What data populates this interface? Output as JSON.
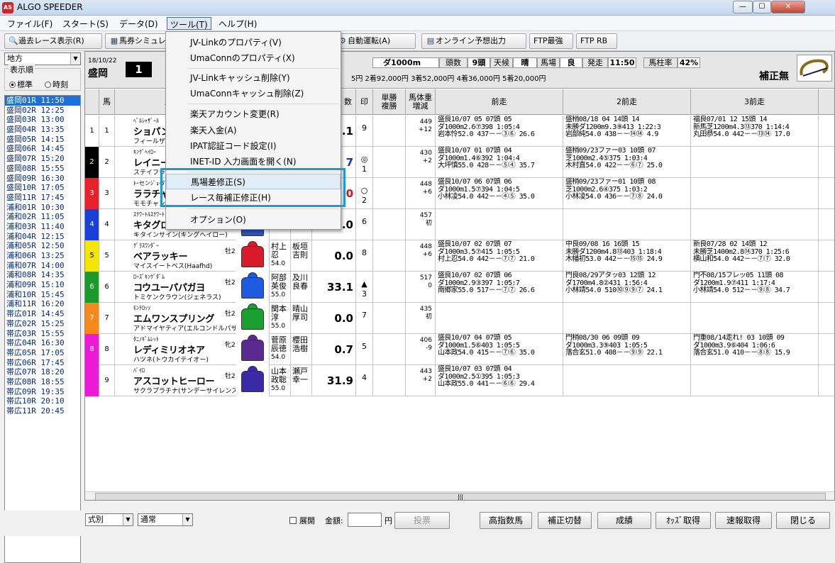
{
  "app": {
    "title": "ALGO SPEEDER",
    "logo": "AS"
  },
  "window": {
    "minimize": "—",
    "maximize": "☐",
    "close": "✕"
  },
  "menus": [
    "ファイル(F)",
    "スタート(S)",
    "データ(D)",
    "ツール(T)",
    "ヘルプ(H)"
  ],
  "toolbar": [
    {
      "label": "過去レース表示(R)",
      "icon": "magnifier-icon"
    },
    {
      "label": "馬券シミュレ",
      "icon": "calculator-icon"
    },
    {
      "label": "自動運転(A)",
      "icon": "auto-icon"
    },
    {
      "label": "オンライン予想出力",
      "icon": "print-icon"
    },
    {
      "label": "FTP最強",
      "icon": ""
    },
    {
      "label": "FTP RB",
      "icon": ""
    }
  ],
  "dropdown_items": [
    "JV-Linkのプロパティ(V)",
    "UmaConnのプロパティ(X)",
    "JV-Linkキャッシュ削除(Y)",
    "UmaConnキャッシュ削除(Z)",
    "楽天アカウント変更(R)",
    "楽天入金(A)",
    "IPAT認証コード設定(I)",
    "INET-ID 入力画面を開く(N)",
    "馬場差修正(S)",
    "レース毎補正修正(H)",
    "オプション(O)"
  ],
  "left": {
    "region": "地方",
    "sort_title": "表示順",
    "sort_standard": "標準",
    "sort_time": "時刻",
    "races": [
      "盛岡01R  11:50",
      "盛岡02R  12:25",
      "盛岡03R  13:00",
      "盛岡04R  13:35",
      "盛岡05R  14:15",
      "盛岡06R  14:45",
      "盛岡07R  15:20",
      "盛岡08R  15:55",
      "盛岡09R  16:30",
      "盛岡10R  17:05",
      "盛岡11R  17:45",
      "浦和01R  10:30",
      "浦和02R  11:05",
      "浦和03R  11:40",
      "浦和04R  12:15",
      "浦和05R  12:50",
      "浦和06R  13:25",
      "浦和07R  14:00",
      "浦和08R  14:35",
      "浦和09R  15:10",
      "浦和10R  15:45",
      "浦和11R  16:20",
      "帯広01R  14:45",
      "帯広02R  15:25",
      "帯広03R  15:55",
      "帯広04R  16:30",
      "帯広05R  17:05",
      "帯広06R  17:45",
      "帯広07R  18:20",
      "帯広08R  18:55",
      "帯広09R  19:35",
      "帯広10R  20:10",
      "帯広11R  20:45"
    ]
  },
  "race": {
    "date": "18/10/22",
    "course": "盛岡",
    "number": "1",
    "distance": "ダ1000m",
    "heads_label": "頭数",
    "heads": "9頭",
    "weather_label": "天候",
    "weather": "晴",
    "track_label": "馬場",
    "track": "良",
    "post_label": "発走",
    "post": "11:50",
    "ratio_label": "馬柱率",
    "ratio": "42%",
    "prizes": "5円  2着92,000円  3着52,000円  4着36,000円  5着20,000円",
    "hosei": "補正無"
  },
  "headers": {
    "uma": "馬",
    "name": "馬",
    "idx": "数",
    "mark": "印",
    "tansho": "単勝\n複勝",
    "bw": "馬体重\n増減",
    "p1": "前走",
    "p2": "2前走",
    "p3": "3前走"
  },
  "horses": [
    {
      "waku": "1",
      "num": "1",
      "color": "#ffffff",
      "sire": "ﾍﾟﾙｼｬｻﾞｰﾙ",
      "name": "ショパンラブ",
      "dam": "フィールザライト(",
      "sexage": "",
      "stable": "",
      "jockey": "",
      "weight": "",
      "trainer": "",
      "odds": ".1",
      "oddscolor": "#000",
      "mark": "",
      "markno": "9",
      "bw": "449",
      "bwd": "+12",
      "silk": "#ffffff",
      "p1": [
        "盛良10/07     05 07頭 05",
        "  ダ1000m2.6⑦398 1:05:4",
        "岩本怜52.0 437－－③⑥ 26.6"
      ],
      "p2": [
        "盛稍08/18     04 14頭 14",
        "未勝ダ1200m9.3⑨413 1:22:3",
        "岩部純54.0 438－－⑭⑭ 4.9"
      ],
      "p3": [
        "福良07/01     12 15頭 14",
        "新馬芝1200m4.3⑬370 1:14:4",
        "丸田恭54.0 442－－⑬⑭ 17.0"
      ]
    },
    {
      "waku": "2",
      "num": "2",
      "color": "#000000",
      "sire": "ｷﾝｸﾞﾍｲﾛｰ",
      "name": "レイニーデビ",
      "dam": "ステイフライイ",
      "sexage": "",
      "stable": "",
      "jockey": "",
      "weight": "",
      "trainer": "",
      "odds": "7",
      "oddscolor": "#1230c8",
      "mark": "◎",
      "markno": "1",
      "bw": "430",
      "bwd": "+2",
      "silk": "#ffffff",
      "p1": [
        "盛良10/07     01 07頭 04",
        "  ダ1000m1.4⑥392 1:04:4",
        "大坪慎55.0 428－－⑤④ 35.7"
      ],
      "p2": [
        "盛稍09/23ファー03 10頭 07",
        "  芝1000m2.4⑤375 1:03:4",
        "木村直54.0 422－－⑥⑦ 25.0"
      ],
      "p3": [
        "",
        "",
        ""
      ]
    },
    {
      "waku": "3",
      "num": "3",
      "color": "#e8202a",
      "sire": "ﾄｰセンｼﾞｮｰﾀﾞﾝ",
      "name": "ララチャン",
      "dam": "モモチャン(ネオ",
      "sexage": "",
      "stable": "",
      "jockey": "",
      "weight": "",
      "trainer": "",
      "odds": "0",
      "oddscolor": "#e01010",
      "mark": "○",
      "markno": "2",
      "bw": "448",
      "bwd": "+6",
      "silk": "#ffffff",
      "p1": [
        "盛良10/07     06 07頭 06",
        "  ダ1000m1.5⑦394 1:04:5",
        "小林凌54.0 442－－④⑤ 35.0"
      ],
      "p2": [
        "盛稍09/23ファー01 10頭 08",
        "  芝1000m2.6④375 1:03:2",
        "小林凌54.0 436－－⑦⑧ 24.0"
      ],
      "p3": [
        "",
        "",
        ""
      ]
    },
    {
      "waku": "4",
      "num": "4",
      "color": "#1a3fd8",
      "sire": "ｽｸﾜｰﾄﾙｽｸﾜｰﾄ",
      "name": "キタグローリ",
      "dam": "キタインサイン(キングヘイロー)",
      "sexage": "",
      "stable": "",
      "jockey": "",
      "weight": "54.0",
      "trainer": "",
      "odds": ".0",
      "oddscolor": "#000",
      "mark": "",
      "markno": "6",
      "bw": "457",
      "bwd": "初",
      "silk": "#2a55c8",
      "p1": [
        "",
        "",
        ""
      ],
      "p2": [
        "",
        "",
        ""
      ],
      "p3": [
        "",
        "",
        ""
      ]
    },
    {
      "waku": "5",
      "num": "5",
      "color": "#f5e600",
      "sire": "ｸﾞﾗｽﾜﾝﾀﾞｰ",
      "name": "ベアラッキー",
      "dam": "マイスイートベス(Haafhd)",
      "sexage": "牡2",
      "stable": "栗",
      "jockey": "村上\n忍",
      "weight": "54.0",
      "trainer": "板垣\n吉則",
      "odds": "0.0",
      "oddscolor": "#000",
      "mark": "",
      "markno": "8",
      "bw": "448",
      "bwd": "+6",
      "silk": "#d81a2a",
      "p1": [
        "盛良10/07     02 07頭 07",
        "  ダ1000m3.5⑦415 1:05:5",
        "村上忍54.0 442－－⑦⑦ 21.0"
      ],
      "p2": [
        "中良09/08     16 16頭 15",
        "未勝ダ1200m4.8⑬403 1:18:4",
        "木幡初53.0 442－－⑮⑮ 24.9"
      ],
      "p3": [
        "新良07/28     02 14頭 12",
        "未勝芝1400m2.8⑭370 1:25:6",
        "横山和54.0 442－－⑦⑦ 32.0"
      ]
    },
    {
      "waku": "6",
      "num": "6",
      "color": "#1a9a2a",
      "sire": "ﾛｰｽﾞｷﾝｸﾞﾀﾞﾑ",
      "name": "コウユーパパガヨ",
      "dam": "トミケンクラウン(ジェネラス)",
      "sexage": "牡2",
      "stable": "鹿",
      "jockey": "阿部\n英俊",
      "weight": "55.0",
      "trainer": "及川\n良春",
      "odds": "33.1",
      "oddscolor": "#000",
      "mark": "▲",
      "markno": "3",
      "bw": "517",
      "bwd": "0",
      "silk": "#1e5ae0",
      "p1": [
        "盛良10/07     02 07頭 06",
        "  ダ1000m2.9③397 1:05:7",
        "南郷家55.0 517－－⑦⑦ 26.6"
      ],
      "p2": [
        "門良08/29アタッ03 12頭 12",
        "  ダ1700m4.8②431 1:56:4",
        "小林靖54.0 510⑩⑨⑨⑦ 24.1"
      ],
      "p3": [
        "門不08/15フレッ05 11頭 08",
        "  ダ1200m1.9⑦411 1:17:4",
        "小林靖54.0 512－－⑨⑧ 34.7"
      ]
    },
    {
      "waku": "7",
      "num": "7",
      "color": "#f58a1a",
      "sire": "ﾓﾝﾃﾛｯｿ",
      "name": "エムワンスプリング",
      "dam": "アドマイヤティア(エルコンドルパサー)",
      "sexage": "牡2",
      "stable": "鹿",
      "jockey": "関本\n淳",
      "weight": "55.0",
      "trainer": "晴山\n厚司",
      "odds": "0.0",
      "oddscolor": "#000",
      "mark": "",
      "markno": "7",
      "bw": "435",
      "bwd": "初",
      "silk": "#1aa030",
      "p1": [
        "",
        "",
        ""
      ],
      "p2": [
        "",
        "",
        ""
      ],
      "p3": [
        "",
        "",
        ""
      ]
    },
    {
      "waku": "8",
      "num": "8",
      "color": "#ec1ad8",
      "sire": "ﾀﾆﾉｷﾞﾑﾚｯﾄ",
      "name": "レディミリオネア",
      "dam": "ハツネ(トウカイテイオー)",
      "sexage": "牝2",
      "stable": "栗",
      "jockey": "菅原\n辰徳",
      "weight": "54.0",
      "trainer": "櫻田\n浩樹",
      "odds": "0.7",
      "oddscolor": "#000",
      "mark": "",
      "markno": "5",
      "bw": "406",
      "bwd": "-9",
      "silk": "#5a2a90",
      "p1": [
        "盛良10/07     04 07頭 05",
        "  ダ1000m1.5⑥403 1:05:5",
        "山本政54.0 415－－⑦⑥ 35.0"
      ],
      "p2": [
        "門稍08/30     06 09頭 09",
        "  ダ1000m3.3⑨403 1:05:5",
        "落合玄51.0 408－－⑨⑨ 22.1"
      ],
      "p3": [
        "門重08/14走れ! 03 10頭 09",
        "  ダ1000m3.9⑥404 1:06:6",
        "落合玄51.0 410－－⑧⑧ 15.9"
      ]
    },
    {
      "waku": "",
      "num": "9",
      "color": "#ec1ad8",
      "sire": "ﾊﾞｲﾛ",
      "name": "アスコットヒーロー",
      "dam": "サクラプラチナ(サンデーサイレンス)",
      "sexage": "牡2",
      "stable": "栗",
      "jockey": "山本\n政聡",
      "weight": "55.0",
      "trainer": "瀬戸\n幸一",
      "odds": "31.9",
      "oddscolor": "#000",
      "mark": "",
      "markno": "4",
      "bw": "443",
      "bwd": "+2",
      "silk": "#3a2aa8",
      "p1": [
        "盛良10/07     03 07頭 04",
        "  ダ1000m2.5①395 1:05:3",
        "山本政55.0 441－－⑥⑥ 29.4"
      ],
      "p2": [
        "",
        "",
        ""
      ],
      "p3": [
        "",
        "",
        ""
      ]
    }
  ],
  "bottom": {
    "sel1": "式別",
    "sel2": "通常",
    "expand": "展開",
    "amount_label": "金額:",
    "amount_unit": "円",
    "buy": "投票",
    "buttons": [
      "高指数馬",
      "補正切替",
      "成績",
      "ｵｯｽﾞ取得",
      "速報取得",
      "閉じる"
    ]
  },
  "colors": {
    "accent": "#1c9ad8",
    "selection": "#1e6fd9"
  }
}
